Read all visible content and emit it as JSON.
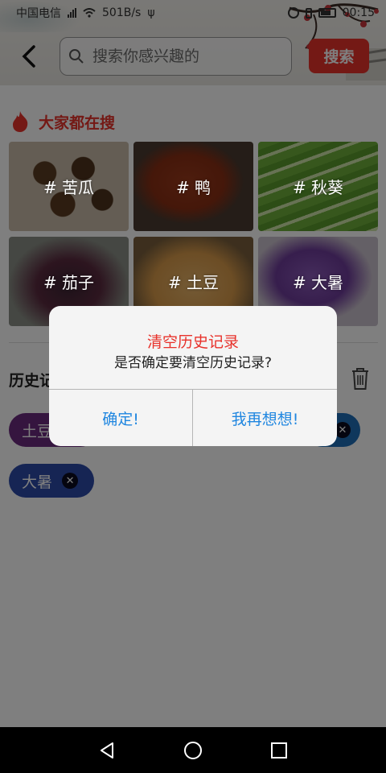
{
  "status_bar": {
    "carrier": "中国电信",
    "speed": "501B/s",
    "time": "00:15"
  },
  "header": {
    "back_icon": "chevron-left-icon",
    "search_placeholder": "搜索你感兴趣的",
    "search_button": "搜索"
  },
  "hot": {
    "title": "大家都在搜",
    "icon": "flame-icon",
    "items": [
      {
        "label": "# 苦瓜"
      },
      {
        "label": "# 鸭"
      },
      {
        "label": "# 秋葵"
      },
      {
        "label": "# 茄子"
      },
      {
        "label": "# 土豆"
      },
      {
        "label": "# 大暑"
      }
    ]
  },
  "history": {
    "title": "历史记录",
    "trash_icon": "trash-icon",
    "chips": [
      {
        "label": "土豆",
        "color": "#6b2a7e"
      },
      {
        "label": "",
        "color": "#1f6fb8"
      },
      {
        "label": "大暑",
        "color": "#2c4aa8"
      }
    ]
  },
  "dialog": {
    "title": "清空历史记录",
    "message": "是否确定要清空历史记录?",
    "confirm": "确定!",
    "cancel": "我再想想!"
  },
  "colors": {
    "accent": "#e8322b",
    "link": "#1f86e0"
  }
}
